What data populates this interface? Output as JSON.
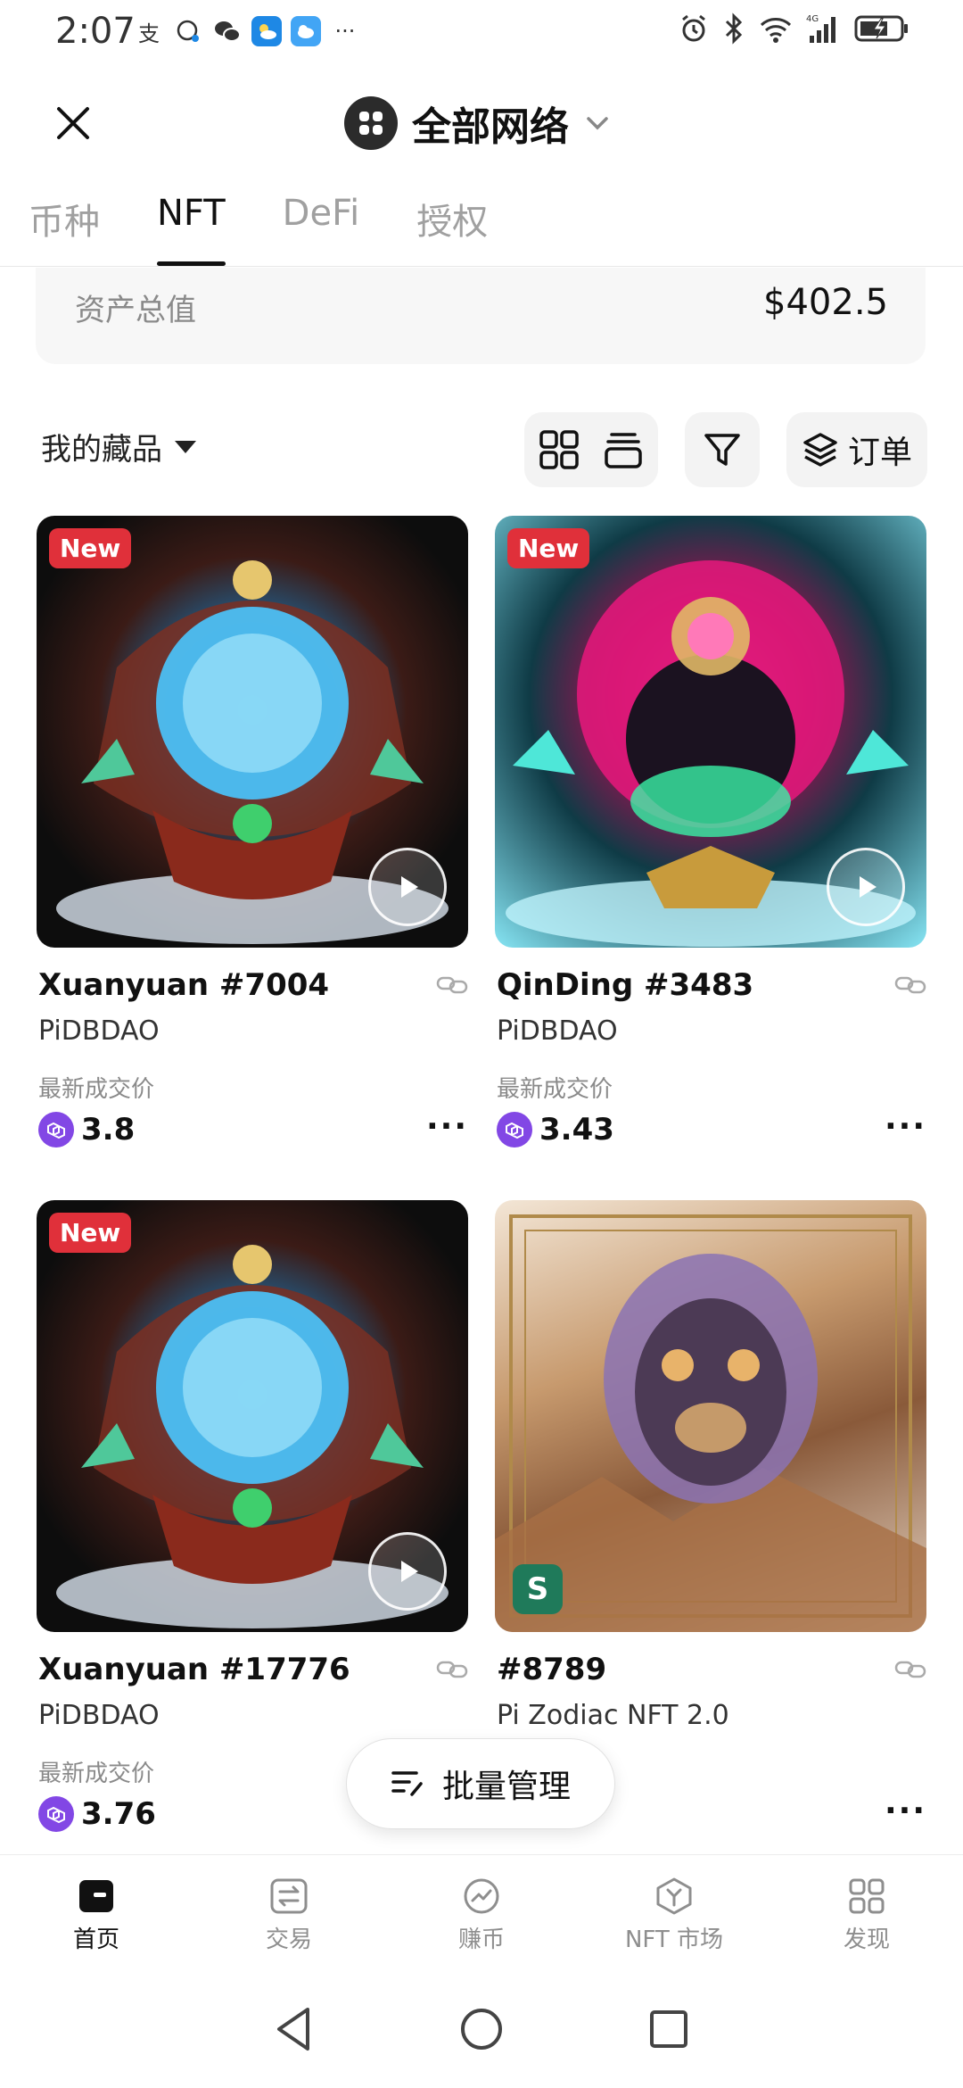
{
  "status_bar": {
    "time": "2:07",
    "battery_icon": "battery-charging-icon"
  },
  "header": {
    "close_icon": "close-icon",
    "network_title": "全部网络",
    "network_icon": "grid-dots-icon",
    "dropdown_icon": "chevron-down-icon"
  },
  "tabs": [
    {
      "label": "币种",
      "active": false
    },
    {
      "label": "NFT",
      "active": true
    },
    {
      "label": "DeFi",
      "active": false
    },
    {
      "label": "授权",
      "active": false
    }
  ],
  "asset_summary": {
    "label": "资产总值",
    "value": "$402.5"
  },
  "toolbar": {
    "collection_select": "我的藏品",
    "view_toggle_icons": [
      "grid-view-icon",
      "stack-view-icon"
    ],
    "filter_icon": "filter-icon",
    "orders_label": "订单",
    "orders_icon": "layers-icon"
  },
  "nfts": [
    {
      "name": "Xuanyuan #7004",
      "collection": "PiDBDAO",
      "price_label": "最新成交价",
      "price": "3.8",
      "badge": "New",
      "has_video": true,
      "theme": "blue-orb"
    },
    {
      "name": "QinDing #3483",
      "collection": "PiDBDAO",
      "price_label": "最新成交价",
      "price": "3.43",
      "badge": "New",
      "has_video": true,
      "theme": "pink-orb"
    },
    {
      "name": "Xuanyuan #17776",
      "collection": "PiDBDAO",
      "price_label": "最新成交价",
      "price": "3.76",
      "badge": "New",
      "has_video": true,
      "theme": "blue-orb"
    },
    {
      "name": "#8789",
      "collection": "Pi Zodiac NFT 2.0",
      "price_label": "",
      "price": "",
      "badge": "",
      "has_video": false,
      "theme": "monkey"
    }
  ],
  "batch_button": {
    "label": "批量管理",
    "icon": "list-edit-icon"
  },
  "bottom_nav": [
    {
      "label": "首页",
      "icon": "wallet-icon",
      "active": true
    },
    {
      "label": "交易",
      "icon": "swap-icon",
      "active": false
    },
    {
      "label": "赚币",
      "icon": "earn-icon",
      "active": false
    },
    {
      "label": "NFT 市场",
      "icon": "nft-market-icon",
      "active": false
    },
    {
      "label": "发现",
      "icon": "discover-icon",
      "active": false
    }
  ],
  "colors": {
    "new_badge": "#e0303a",
    "coin": "#8247e5",
    "active_text": "#111111",
    "muted_text": "#a0a0a0"
  }
}
